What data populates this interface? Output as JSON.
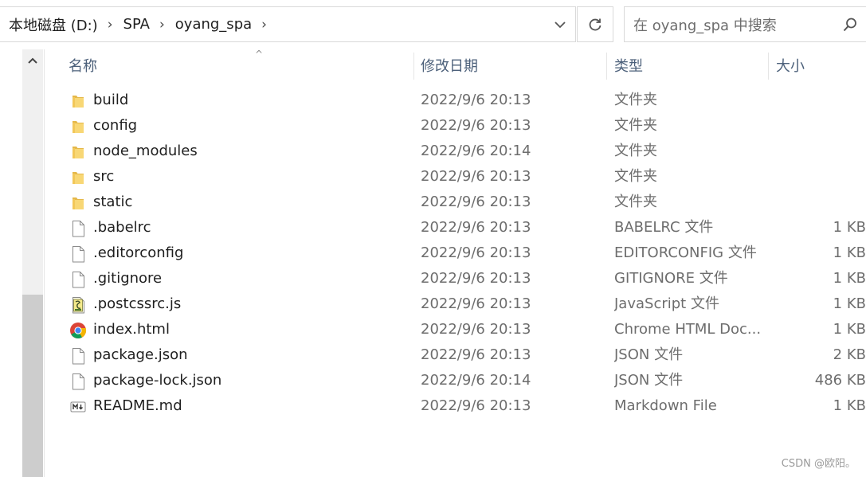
{
  "breadcrumb": [
    "本地磁盘 (D:)",
    "SPA",
    "oyang_spa"
  ],
  "search": {
    "placeholder": "在 oyang_spa 中搜索"
  },
  "columns": {
    "name": "名称",
    "date": "修改日期",
    "type": "类型",
    "size": "大小"
  },
  "files": [
    {
      "name": "build",
      "date": "2022/9/6 20:13",
      "type": "文件夹",
      "size": "",
      "icon": "folder-icon"
    },
    {
      "name": "config",
      "date": "2022/9/6 20:13",
      "type": "文件夹",
      "size": "",
      "icon": "folder-icon"
    },
    {
      "name": "node_modules",
      "date": "2022/9/6 20:14",
      "type": "文件夹",
      "size": "",
      "icon": "folder-icon"
    },
    {
      "name": "src",
      "date": "2022/9/6 20:13",
      "type": "文件夹",
      "size": "",
      "icon": "folder-icon"
    },
    {
      "name": "static",
      "date": "2022/9/6 20:13",
      "type": "文件夹",
      "size": "",
      "icon": "folder-icon"
    },
    {
      "name": ".babelrc",
      "date": "2022/9/6 20:13",
      "type": "BABELRC 文件",
      "size": "1 KB",
      "icon": "file-icon"
    },
    {
      "name": ".editorconfig",
      "date": "2022/9/6 20:13",
      "type": "EDITORCONFIG 文件",
      "size": "1 KB",
      "icon": "file-icon"
    },
    {
      "name": ".gitignore",
      "date": "2022/9/6 20:13",
      "type": "GITIGNORE 文件",
      "size": "1 KB",
      "icon": "file-icon"
    },
    {
      "name": ".postcssrc.js",
      "date": "2022/9/6 20:13",
      "type": "JavaScript 文件",
      "size": "1 KB",
      "icon": "js-script-icon"
    },
    {
      "name": "index.html",
      "date": "2022/9/6 20:13",
      "type": "Chrome HTML Doc...",
      "size": "1 KB",
      "icon": "chrome-icon"
    },
    {
      "name": "package.json",
      "date": "2022/9/6 20:13",
      "type": "JSON 文件",
      "size": "2 KB",
      "icon": "file-icon"
    },
    {
      "name": "package-lock.json",
      "date": "2022/9/6 20:14",
      "type": "JSON 文件",
      "size": "486 KB",
      "icon": "file-icon"
    },
    {
      "name": "README.md",
      "date": "2022/9/6 20:13",
      "type": "Markdown File",
      "size": "1 KB",
      "icon": "markdown-icon"
    }
  ],
  "watermark": "CSDN @欧阳。",
  "colors": {
    "folder": "#f8d775",
    "folder_dark": "#e5b84a",
    "header_text": "#4c607a"
  }
}
